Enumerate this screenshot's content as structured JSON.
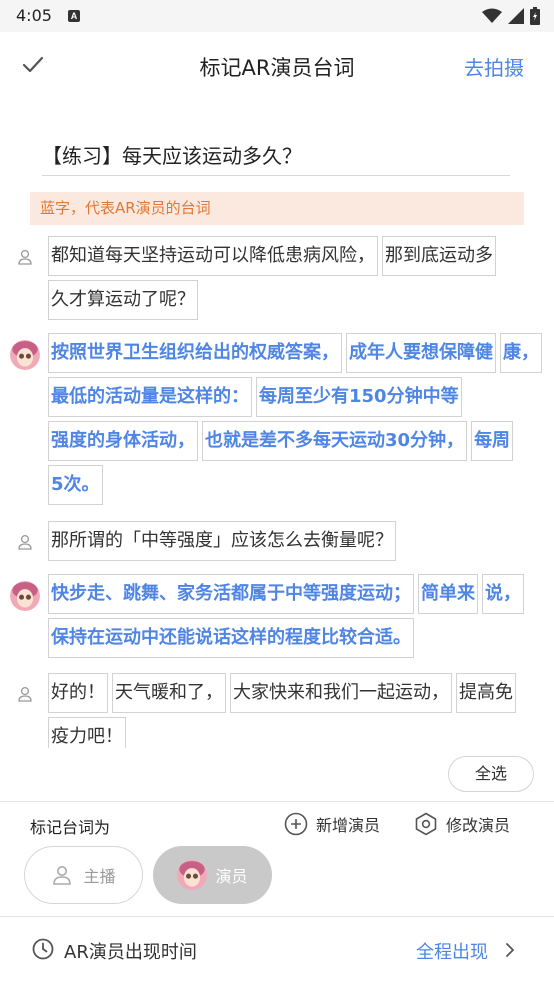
{
  "status_bar": {
    "time": "4:05",
    "notif_letter": "A"
  },
  "header": {
    "title": "标记AR演员台词",
    "action": "去拍摄"
  },
  "script_title": "【练习】每天应该运动多久？",
  "hint": "蓝字，代表AR演员的台词",
  "lines": [
    {
      "speaker": "host",
      "chunks": [
        "都知道每天坚持运动可以降低患病风险，",
        "那到底运动多",
        "久才算运动了呢？"
      ]
    },
    {
      "speaker": "actor",
      "chunks": [
        "按照世界卫生组织给出的权威答案，",
        "成年人要想保障健",
        "康，",
        "最低的活动量是这样的：",
        "每周至少有150分钟中等",
        "强度的身体活动，",
        "也就是差不多每天运动30分钟，",
        "每周",
        "5次。"
      ]
    },
    {
      "speaker": "host",
      "chunks": [
        "那所谓的「中等强度」应该怎么去衡量呢？"
      ]
    },
    {
      "speaker": "actor",
      "chunks": [
        "快步走、跳舞、家务活都属于中等强度运动；",
        "简单来",
        "说，",
        "保持在运动中还能说话这样的程度比较合适。"
      ]
    },
    {
      "speaker": "host",
      "chunks": [
        "好的！",
        "天气暖和了，",
        "大家快来和我们一起运动，",
        "提高免",
        "疫力吧！"
      ]
    }
  ],
  "select_all": "全选",
  "bottom": {
    "mark_label": "标记台词为",
    "add_actor": "新增演员",
    "edit_actor": "修改演员",
    "role_host": "主播",
    "role_actor": "演员",
    "appear_label": "AR演员出现时间",
    "appear_value": "全程出现"
  },
  "colors": {
    "accent": "#4f86e6",
    "hint_text": "#e07836",
    "hint_bg": "#fbe9df",
    "selected_role_bg": "#c9c9c9"
  }
}
